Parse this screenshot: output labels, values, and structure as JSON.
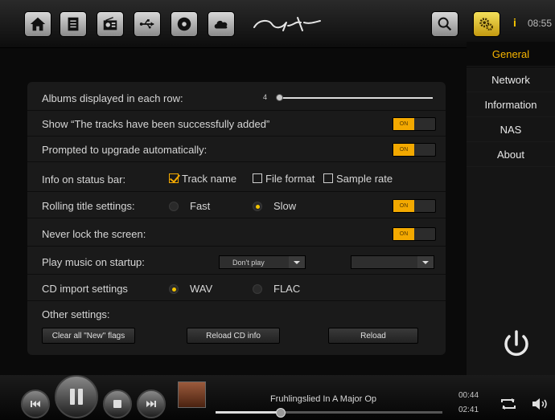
{
  "topbar": {
    "icons": [
      "home-icon",
      "document-icon",
      "radio-icon",
      "usb-icon",
      "disc-icon",
      "cloud-icon"
    ],
    "time": "08:55",
    "info_label": "i"
  },
  "sidebar": {
    "items": [
      {
        "label": "General",
        "active": true
      },
      {
        "label": "Network"
      },
      {
        "label": "Information"
      },
      {
        "label": "NAS"
      },
      {
        "label": "About"
      }
    ]
  },
  "settings": {
    "albums_row": {
      "label": "Albums displayed in each row:",
      "value": "4"
    },
    "tracks_added": {
      "label": "Show “The tracks have been successfully added”",
      "toggle": "ON"
    },
    "upgrade": {
      "label": "Prompted to upgrade automatically:",
      "toggle": "ON"
    },
    "status_bar": {
      "label": "Info on status bar:",
      "options": [
        {
          "label": "Track name",
          "checked": true
        },
        {
          "label": "File format",
          "checked": false
        },
        {
          "label": "Sample rate",
          "checked": false
        }
      ]
    },
    "rolling": {
      "label": "Rolling title settings:",
      "options": [
        {
          "label": "Fast",
          "selected": false
        },
        {
          "label": "Slow",
          "selected": true
        }
      ],
      "toggle": "ON"
    },
    "lock": {
      "label": "Never lock the screen:",
      "toggle": "ON"
    },
    "startup": {
      "label": "Play music on startup:",
      "select_value": "Don't play",
      "second_select_value": ""
    },
    "cd_import": {
      "label": "CD import settings",
      "options": [
        {
          "label": "WAV",
          "selected": true
        },
        {
          "label": "FLAC",
          "selected": false
        }
      ]
    },
    "other": {
      "label": "Other settings:",
      "buttons": [
        "Clear all \"New\" flags",
        "Reload CD info",
        "Reload"
      ]
    }
  },
  "player": {
    "track_title": "Fruhlingslied In A Major Op",
    "elapsed": "00:44",
    "total": "02:41",
    "progress": 0.29
  },
  "colors": {
    "accent": "#f3a900",
    "active_tab": "#f7b500"
  }
}
